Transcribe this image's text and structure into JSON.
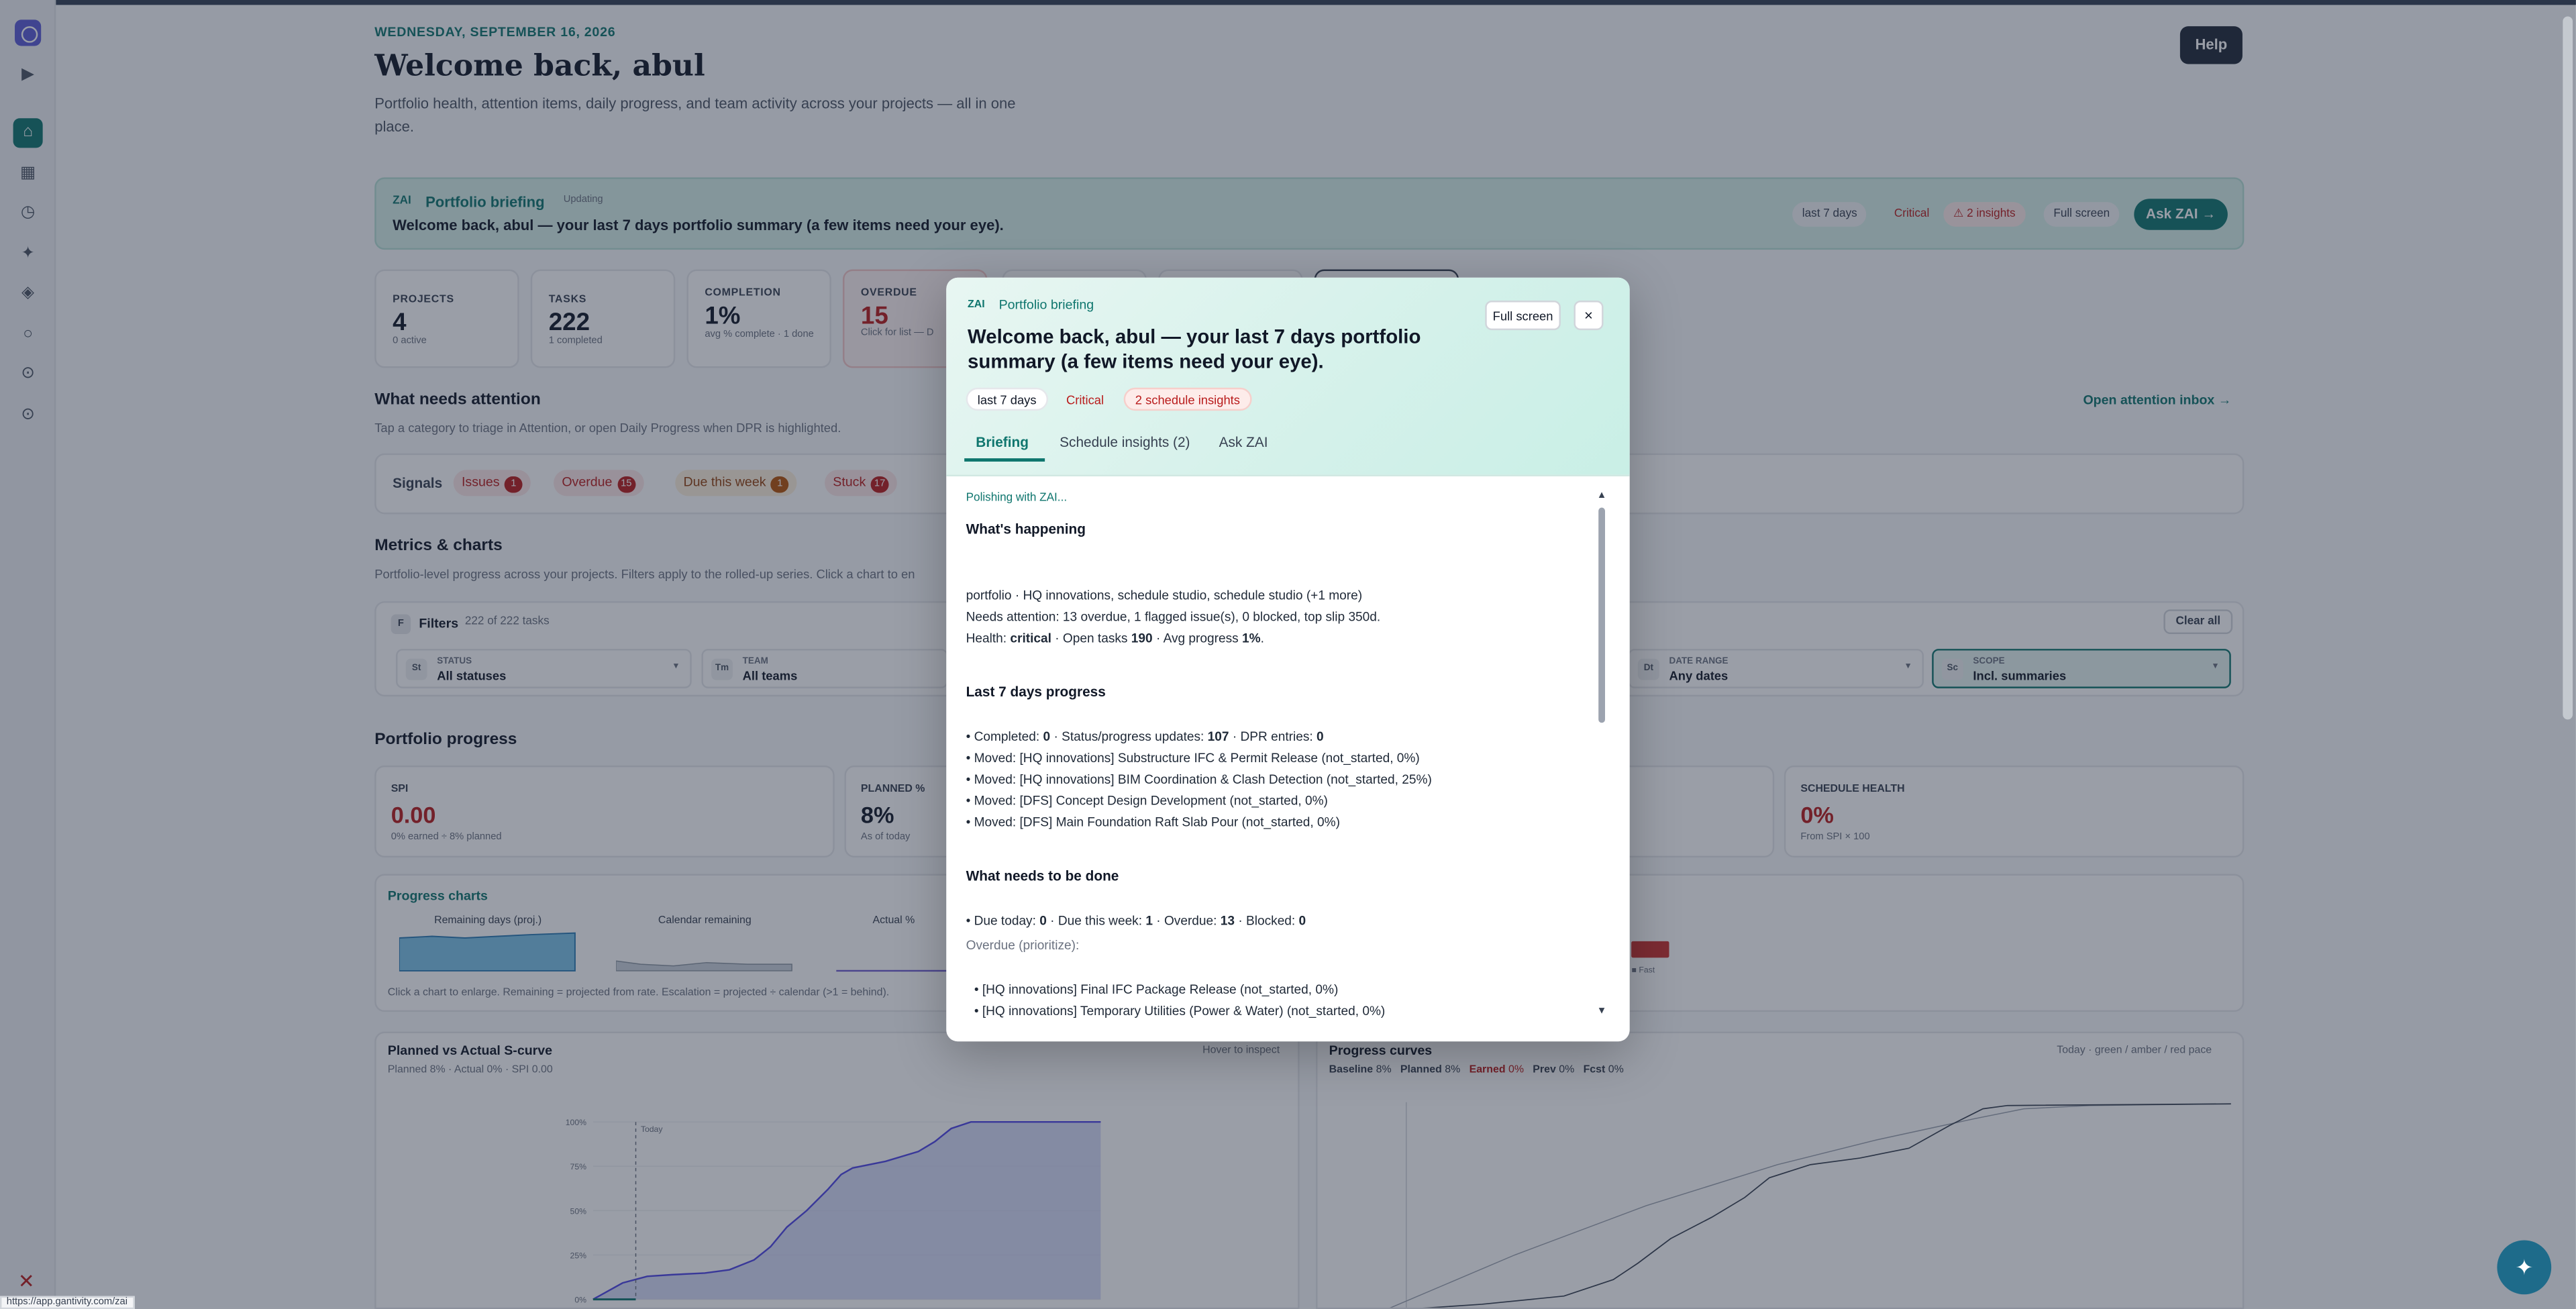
{
  "header": {
    "date": "WEDNESDAY, SEPTEMBER 16, 2026",
    "welcome": "Welcome back, abul",
    "subtitle": "Portfolio health, attention items, daily progress, and team activity across your projects — all in one place.",
    "help": "Help"
  },
  "sidebar": {
    "icons": [
      "play-icon",
      "home-icon",
      "grid-icon",
      "clock-icon",
      "sparkle-icon",
      "diamond-icon",
      "circle-icon",
      "settings-icon",
      "settings-icon"
    ]
  },
  "briefing_bar": {
    "zai": "ZAI",
    "title": "Portfolio briefing",
    "status": "Updating",
    "text": "Welcome back, abul — your last 7 days portfolio summary (a few items need your eye).",
    "chip_range": "last 7 days",
    "chip_critical": "Critical",
    "chip_insights": "⚠ 2 insights",
    "full_screen": "Full screen",
    "ask": "Ask ZAI →"
  },
  "kpis": [
    {
      "label": "PROJECTS",
      "value": "4",
      "sub": "0 active"
    },
    {
      "label": "TASKS",
      "value": "222",
      "sub": "1 completed"
    },
    {
      "label": "COMPLETION",
      "value": "1%",
      "sub": "avg % complete · 1 done"
    },
    {
      "label": "OVERDUE",
      "value": "15",
      "sub": "Click for list — D"
    }
  ],
  "attention": {
    "title": "What needs attention",
    "sub": "Tap a category to triage in Attention, or open Daily Progress when DPR is highlighted.",
    "open_inbox": "Open attention inbox →",
    "signals_label": "Signals",
    "signals": [
      {
        "label": "Issues",
        "count": "1"
      },
      {
        "label": "Overdue",
        "count": "15"
      },
      {
        "label": "Due this week",
        "count": "1"
      },
      {
        "label": "Stuck",
        "count": "17"
      }
    ]
  },
  "metrics": {
    "title": "Metrics & charts",
    "sub": "Portfolio-level progress across your projects. Filters apply to the rolled-up series. Click a chart to en",
    "filters_badge": "F",
    "filters_title": "Filters",
    "filters_count": "222 of 222 tasks",
    "clear_all": "Clear all",
    "boxes": [
      {
        "code": "St",
        "label": "STATUS",
        "value": "All statuses"
      },
      {
        "code": "Tm",
        "label": "TEAM",
        "value": "All teams"
      },
      {
        "code": "Dt",
        "label": "DATE RANGE",
        "value": "Any dates"
      },
      {
        "code": "Sc",
        "label": "SCOPE",
        "value": "Incl. summaries"
      }
    ]
  },
  "progress": {
    "title": "Portfolio progress",
    "cards": [
      {
        "label": "SPI",
        "value": "0.00",
        "sub": "0% earned ÷ 8% planned"
      },
      {
        "label": "PLANNED %",
        "value": "8%",
        "sub": "As of today"
      },
      {
        "label": "SCHEDULE HEALTH",
        "value": "0%",
        "sub": "From SPI × 100"
      }
    ],
    "charts_title": "Progress charts",
    "mini_titles": [
      "Remaining days (proj.)",
      "Calendar remaining",
      "Actual %"
    ],
    "charts_foot": "Click a chart to enlarge. Remaining = projected from rate. Escalation = projected ÷ calendar (>1 = behind).",
    "legend_snippet": "ack ■ Fast"
  },
  "scurve": {
    "title": "Planned vs Actual S-curve",
    "sub": "Planned 8% · Actual 0% · SPI 0.00",
    "hover": "Hover to inspect",
    "today": "Today",
    "y_ticks": [
      "100%",
      "75%",
      "50%",
      "25%",
      "0%"
    ]
  },
  "curves": {
    "title": "Progress curves",
    "right": "Today · green / amber / red pace",
    "legend": [
      {
        "label": "Baseline",
        "value": "8%"
      },
      {
        "label": "Planned",
        "value": "8%"
      },
      {
        "label": "Earned",
        "value": "0%"
      },
      {
        "label": "Prev",
        "value": "0%"
      },
      {
        "label": "Fcst",
        "value": "0%"
      }
    ]
  },
  "modal": {
    "zai": "ZAI",
    "label": "Portfolio briefing",
    "title": "Welcome back, abul — your last 7 days portfolio summary (a few items need your eye).",
    "chip_range": "last 7 days",
    "chip_critical": "Critical",
    "chip_insights": "2 schedule insights",
    "full_screen": "Full screen",
    "close": "×",
    "tabs": [
      "Briefing",
      "Schedule insights (2)",
      "Ask ZAI"
    ],
    "polishing": "Polishing with ZAI...",
    "h_happening": "What's happening",
    "happening_1": "portfolio · HQ innovations, schedule studio, schedule studio (+1 more)",
    "happening_2": "Needs attention: 13 overdue, 1 flagged issue(s), 0 blocked, top slip 350d.",
    "health_prefix": "Health: ",
    "health_val": "critical",
    "health_mid": " · Open tasks ",
    "open_tasks": "190",
    "health_mid2": " · Avg progress ",
    "avg_progress": "1%",
    "health_end": ".",
    "h_progress": "Last 7 days progress",
    "prog_prefix": "• Completed: ",
    "completed": "0",
    "prog_mid": " · Status/progress updates: ",
    "updates": "107",
    "prog_mid2": " · DPR entries: ",
    "dpr": "0",
    "moves": [
      "• Moved: [HQ innovations] Substructure IFC & Permit Release (not_started, 0%)",
      "• Moved: [HQ innovations] BIM Coordination & Clash Detection (not_started, 25%)",
      "• Moved: [DFS] Concept Design Development (not_started, 0%)",
      "• Moved: [DFS] Main Foundation Raft Slab Pour (not_started, 0%)"
    ],
    "h_todo": "What needs to be done",
    "due_prefix": "• Due today: ",
    "due_today": "0",
    "due_mid": " · Due this week: ",
    "due_week": "1",
    "due_mid2": " · Overdue: ",
    "overdue": "13",
    "due_mid3": " · Blocked: ",
    "blocked": "0",
    "overdue_label": "Overdue (prioritize):",
    "overdue_items": [
      "• [HQ innovations] Final IFC Package Release (not_started, 0%)",
      "• [HQ innovations] Temporary Utilities (Power & Water) (not_started, 0%)"
    ]
  },
  "status_url": "https://app.gantivity.com/zai",
  "fab": "✦"
}
